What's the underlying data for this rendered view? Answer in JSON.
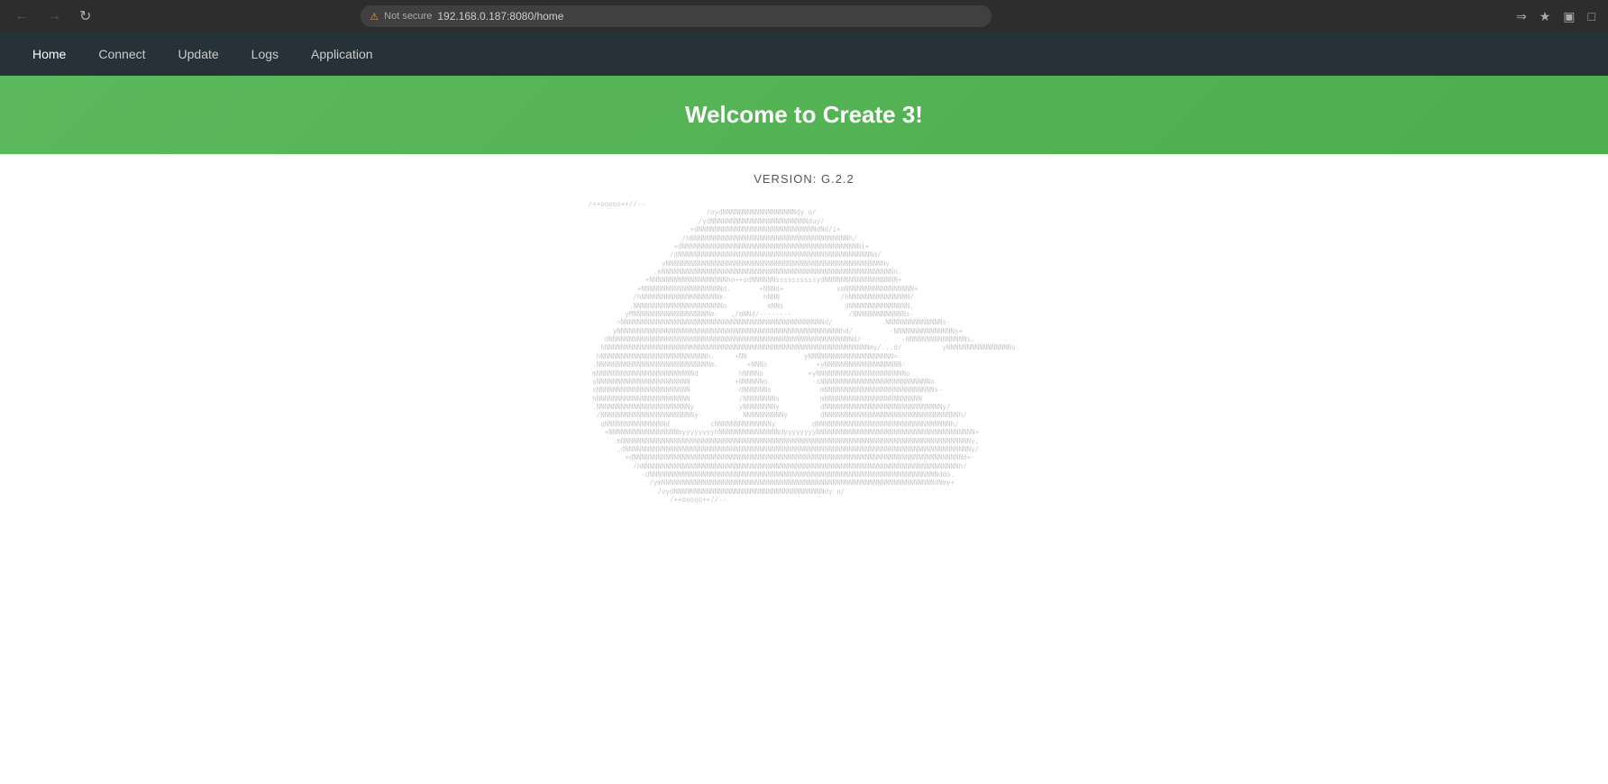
{
  "browser": {
    "url": "192.168.0.187:8080/home",
    "not_secure_label": "Not secure",
    "nav_back_disabled": true,
    "nav_forward_disabled": true
  },
  "navbar": {
    "items": [
      {
        "label": "Home",
        "active": true
      },
      {
        "label": "Connect",
        "active": false
      },
      {
        "label": "Update",
        "active": false
      },
      {
        "label": "Logs",
        "active": false
      },
      {
        "label": "Application",
        "active": false
      }
    ]
  },
  "hero": {
    "title": "Welcome to Create 3!"
  },
  "main": {
    "version_label": "VERSION:",
    "version_value": "G.2.2"
  }
}
